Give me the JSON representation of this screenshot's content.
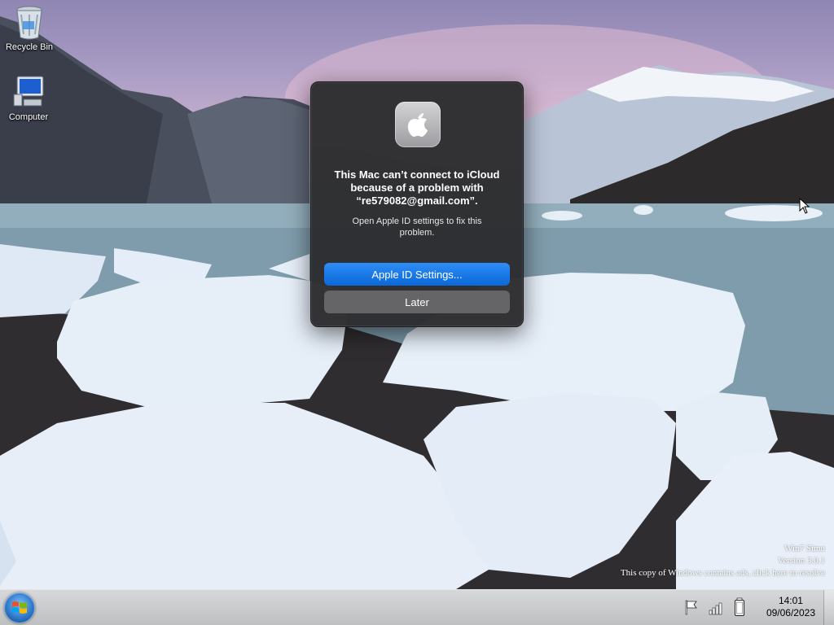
{
  "desktop": {
    "icons": [
      {
        "label": "Recycle Bin",
        "icon": "recycle-bin-icon"
      },
      {
        "label": "Computer",
        "icon": "computer-icon"
      }
    ],
    "watermark": {
      "line1": "Win7 Simu",
      "line2": "Version 3.0.1",
      "line3": "This copy of Windows contains ads, click here to resolve"
    }
  },
  "dialog": {
    "app_icon": "apple-logo-icon",
    "title": "This Mac can’t connect to iCloud because of a problem with “re579082@gmail.com”.",
    "message": "Open Apple ID settings to fix this problem.",
    "primary_button": "Apple ID Settings...",
    "secondary_button": "Later",
    "colors": {
      "background": "#2c2c2e",
      "primary": "#1f7ce8",
      "secondary": "#656568"
    }
  },
  "taskbar": {
    "start_icon": "windows-logo-icon",
    "tray": [
      "flag-icon",
      "signal-icon",
      "battery-icon"
    ],
    "clock": {
      "time": "14:01",
      "date": "09/06/2023"
    }
  }
}
